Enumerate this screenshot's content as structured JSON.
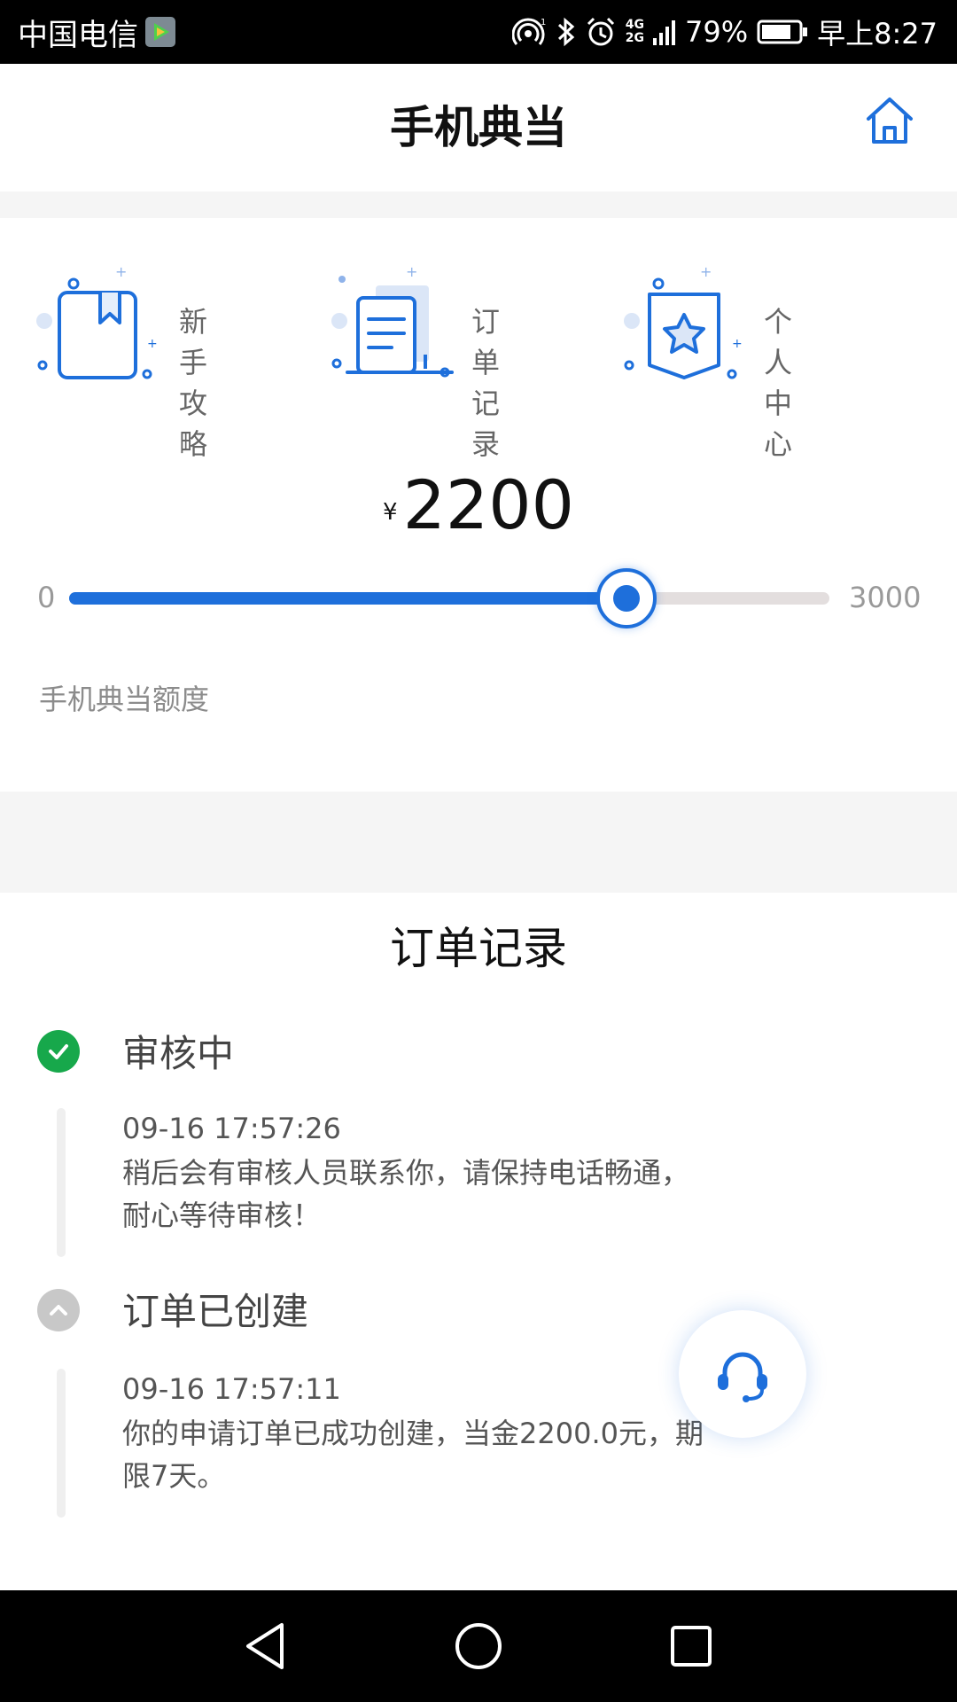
{
  "status_bar": {
    "carrier": "中国电信",
    "network_top": "4G",
    "network_bottom": "2G",
    "battery": "79%",
    "time": "早上8:27"
  },
  "header": {
    "title": "手机典当"
  },
  "quick_nav": [
    {
      "label": "新手攻略",
      "icon": "book-icon"
    },
    {
      "label": "订单记录",
      "icon": "documents-icon"
    },
    {
      "label": "个人中心",
      "icon": "star-badge-icon"
    }
  ],
  "amount": {
    "currency": "¥",
    "value": "2200"
  },
  "slider": {
    "min_label": "0",
    "max_label": "3000",
    "min": 0,
    "max": 3000,
    "value": 2200
  },
  "quota_label": "手机典当额度",
  "orders": {
    "title": "订单记录",
    "steps": [
      {
        "title": "审核中",
        "time": "09-16 17:57:26",
        "lines": [
          "稍后会有审核人员联系你，请保持电话畅通，",
          "耐心等待审核！"
        ],
        "status": "done"
      },
      {
        "title": "订单已创建",
        "time": "09-16 17:57:11",
        "lines": [
          "你的申请订单已成功创建，当金2200.0元，期",
          "限7天。"
        ],
        "status": "collapsed"
      }
    ]
  },
  "colors": {
    "accent": "#1e6fdb",
    "success": "#17a84b",
    "muted": "#c8c8c8"
  }
}
